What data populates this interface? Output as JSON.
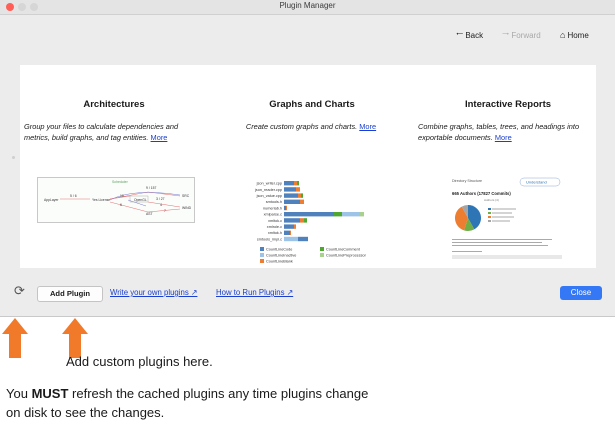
{
  "window": {
    "title": "Plugin Manager"
  },
  "nav": {
    "back": "Back",
    "forward": "Forward",
    "home": "Home"
  },
  "cards": [
    {
      "title": "Architectures",
      "desc": "Group your files to calculate dependencies and metrics, build graphs, and tag entities.",
      "more": "More"
    },
    {
      "title": "Graphs and Charts",
      "desc": "Create custom graphs and charts.",
      "more": "More"
    },
    {
      "title": "Interactive Reports",
      "desc": "Combine graphs, tables, trees, and headings into exportable documents.",
      "more": "More"
    }
  ],
  "arch_thumb": {
    "header": "Scheduler",
    "nodes": [
      "AppLayer",
      "Yes License",
      "OpenGL",
      "AST",
      "SRC",
      "WIND"
    ],
    "edge_labels": [
      "9 / 157",
      "5 / 6",
      "10",
      "6",
      "3 / 27",
      "4",
      "7"
    ]
  },
  "graph_thumb": {
    "categories": [
      "json_writer.cpp",
      "json_reader.cpp",
      "json_value.cpp",
      "smtools.h",
      "numeriab.h",
      "xmlparse.c",
      "xmltok.c",
      "xmlrole.c",
      "xmltok.h",
      "smtools_impl.c"
    ],
    "legend": [
      "CountLineCode",
      "CountLineComment",
      "CountLineInactive",
      "CountLinePreprocessor",
      "CountLineBlank"
    ],
    "colors": [
      "#4f81bd",
      "#4ea72e",
      "#9dc3e6",
      "#a9d18e",
      "#ed7d31"
    ]
  },
  "report_thumb": {
    "header": "Directory Structure",
    "brand": "Understand",
    "headline": "665 Authors (17827 Commits)",
    "subtitle": "Authors (4)",
    "pie_colors": [
      "#2e75b6",
      "#70ad47",
      "#ed7d31",
      "#a5a5a5"
    ]
  },
  "footer": {
    "add_plugin": "Add Plugin",
    "write_own": "Write your own plugins ↗",
    "how_to_run": "How to Run Plugins ↗",
    "close": "Close"
  },
  "annotations": {
    "add_custom": "Add custom plugins here.",
    "refresh_prefix": "You ",
    "refresh_bold": "MUST",
    "refresh_rest": " refresh the cached plugins any time plugins change on disk to see the changes."
  },
  "colors": {
    "accent": "#3478f6",
    "link": "#1a3fcf",
    "arrow": "#f07a2a"
  }
}
